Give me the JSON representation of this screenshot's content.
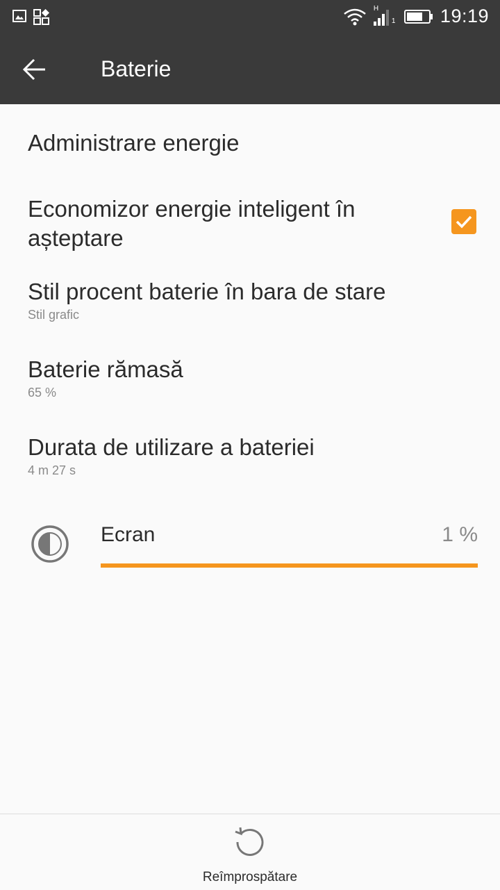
{
  "status_bar": {
    "time": "19:19",
    "icons_left": [
      "image-icon",
      "apps-icon"
    ],
    "icons_right": [
      "wifi-icon",
      "signal-icon",
      "battery-icon"
    ],
    "network_label": "H",
    "sim_label": "1"
  },
  "app_bar": {
    "title": "Baterie",
    "back_icon": "arrow-left-icon"
  },
  "prefs": {
    "power_management": {
      "title": "Administrare energie"
    },
    "smart_standby": {
      "title": "Economizor energie inteligent în așteptare",
      "checked": true
    },
    "percent_style": {
      "title": "Stil procent baterie în bara de stare",
      "summary": "Stil grafic"
    },
    "remaining": {
      "title": "Baterie rămasă",
      "summary": "65 %"
    },
    "usage_time": {
      "title": "Durata de utilizare a bateriei",
      "summary": "4 m 27 s"
    }
  },
  "usage_list": [
    {
      "label": "Ecran",
      "percent_text": "1 %",
      "fill_fraction": 1.0,
      "icon": "brightness-icon"
    }
  ],
  "bottom": {
    "refresh_label": "Reîmprospătare",
    "refresh_icon": "refresh-icon"
  },
  "colors": {
    "accent": "#f5961e",
    "toolbar": "#3a3a3a",
    "background": "#fafafa"
  }
}
